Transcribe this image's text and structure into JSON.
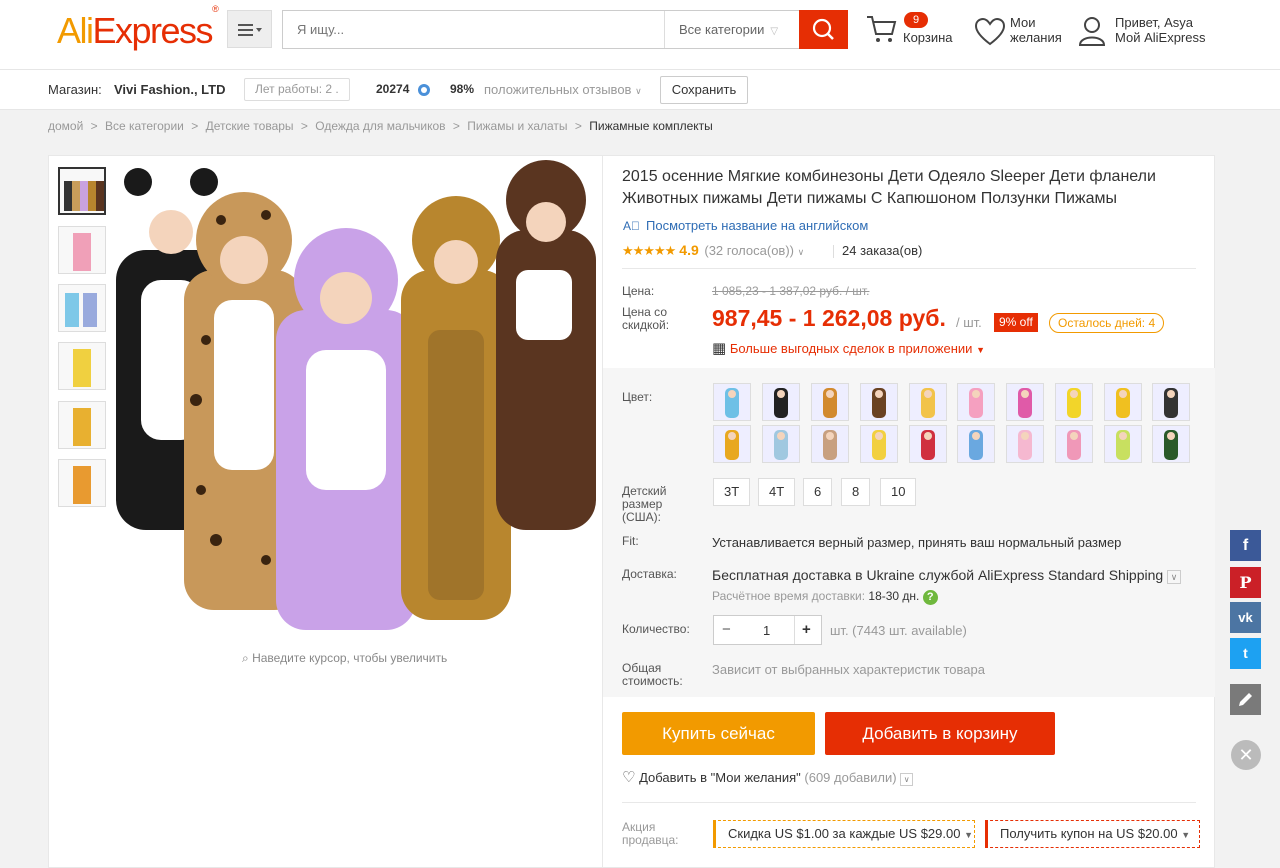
{
  "header": {
    "logo_a": "Ali",
    "logo_b": "Express",
    "logo_mark": "®",
    "menu_icon": "menu-icon",
    "search_placeholder": "Я ищу...",
    "category": "Все категории",
    "cart_count": "9",
    "cart_label": "Корзина",
    "wish_label_1": "Мои",
    "wish_label_2": "желания",
    "user_greeting": "Привет, Asya",
    "user_link": "Мой AliExpress"
  },
  "store": {
    "shop_label": "Магазин:",
    "shop_name": "Vivi Fashion., LTD",
    "years": "Лет работы: 2 .",
    "score": "20274",
    "positive_pct": "98%",
    "positive_label": "положительных отзывов",
    "save": "Сохранить"
  },
  "breadcrumb": [
    "домой",
    ">",
    "Все категории",
    ">",
    "Детские товары",
    ">",
    "Одежда для мальчиков",
    ">",
    "Пижамы и халаты",
    ">",
    "Пижамные комплекты"
  ],
  "gallery": {
    "zoom_hint": "Наведите курсор, чтобы увеличить"
  },
  "product": {
    "title": "2015 осенние Мягкие комбинезоны Дети Одеяло Sleeper Дети фланели Животных пижамы Дети пижамы С Капюшоном Ползунки Пижамы",
    "english_link": "Посмотреть название на английском",
    "stars": "★★★★★",
    "rating": "4.9",
    "votes": "(32 голоса(ов))",
    "orders": "24 заказа(ов)",
    "price_label": "Цена:",
    "old_price": "1 085,23 - 1 387,02 руб. / шт.",
    "discount_label_1": "Цена со",
    "discount_label_2": "скидкой:",
    "new_price": "987,45 - 1 262,08 руб.",
    "per_unit": "/ шт.",
    "off_badge": "9% off",
    "days_left": "Осталось дней: 4",
    "app_deals": "Больше выгодных сделок в приложении",
    "color_label": "Цвет:",
    "size_label_1": "Детский",
    "size_label_2": "размер",
    "size_label_3": "(США):",
    "sizes": [
      "3T",
      "4T",
      "6",
      "8",
      "10"
    ],
    "fit_label": "Fit:",
    "fit_value": "Устанавливается верный размер, принять ваш нормальный размер",
    "shipping_label": "Доставка:",
    "shipping_value": "Бесплатная доставка в Ukraine службой AliExpress Standard Shipping",
    "delivery_time_label": "Расчётное время доставки:",
    "delivery_time": "18-30 дн.",
    "qty_label": "Количество:",
    "qty_value": "1",
    "qty_avail": "шт. (7443 шт. available)",
    "total_label_1": "Общая",
    "total_label_2": "стоимость:",
    "total_value": "Зависит от выбранных характеристик товара",
    "buy_now": "Купить сейчас",
    "add_cart": "Добавить в корзину",
    "wish_text": "Добавить в \"Мои желания\"",
    "wish_count": "(609 добавили)",
    "promo_label_1": "Акция",
    "promo_label_2": "продавца:",
    "promo_discount": "Скидка US $1.00 за каждые US $29.00",
    "promo_coupon": "Получить купон на US $20.00"
  },
  "colors": {
    "brand_orange": "#f29a00",
    "brand_red": "#e62e04",
    "link_blue": "#2f6db5"
  },
  "social": [
    "f",
    "P",
    "vk",
    "t"
  ]
}
